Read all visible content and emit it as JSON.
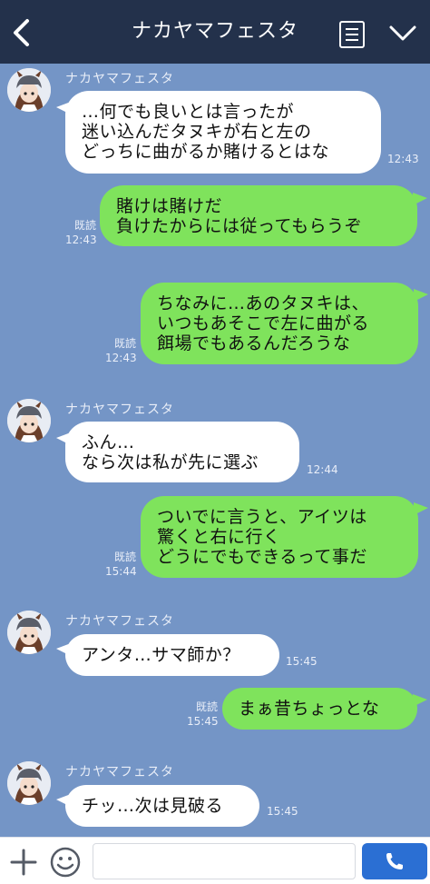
{
  "header": {
    "title": "ナカヤマフェスタ",
    "back_icon": "back-chevron-icon",
    "menu_icon": "menu-list-icon",
    "dropdown_icon": "chevron-down-icon"
  },
  "messages": [
    {
      "side": "in",
      "sender": "ナカヤマフェスタ",
      "text": "…何でも良いとは言ったが\n迷い込んだタヌキが右と左の\nどっちに曲がるか賭けるとはな",
      "time": "12:43"
    },
    {
      "side": "out",
      "read": "既読",
      "time": "12:43",
      "text": "賭けは賭けだ\n負けたからには従ってもらうぞ"
    },
    {
      "side": "out",
      "read": "既読",
      "time": "12:43",
      "text": "ちなみに…あのタヌキは、\nいつもあそこで左に曲がる\n餌場でもあるんだろうな"
    },
    {
      "side": "in",
      "sender": "ナカヤマフェスタ",
      "text": "ふん…\nなら次は私が先に選ぶ",
      "time": "12:44"
    },
    {
      "side": "out",
      "read": "既読",
      "time": "15:44",
      "text": "ついでに言うと、アイツは\n驚くと右に行く\nどうにでもできるって事だ"
    },
    {
      "side": "in",
      "sender": "ナカヤマフェスタ",
      "text": "アンタ…サマ師か？",
      "time": "15:45"
    },
    {
      "side": "out",
      "read": "既読",
      "time": "15:45",
      "text": "まぁ昔ちょっとな"
    },
    {
      "side": "in",
      "sender": "ナカヤマフェスタ",
      "text": "チッ…次は見破る",
      "time": "15:45"
    }
  ],
  "footer": {
    "plus_icon": "plus-icon",
    "emoji_icon": "smile-icon",
    "input_value": "",
    "input_placeholder": "",
    "call_icon": "phone-icon"
  },
  "colors": {
    "background": "#7495c6",
    "header": "#23314b",
    "bubble_in": "#ffffff",
    "bubble_out": "#7fe35c",
    "call_button": "#2b6fd3"
  }
}
